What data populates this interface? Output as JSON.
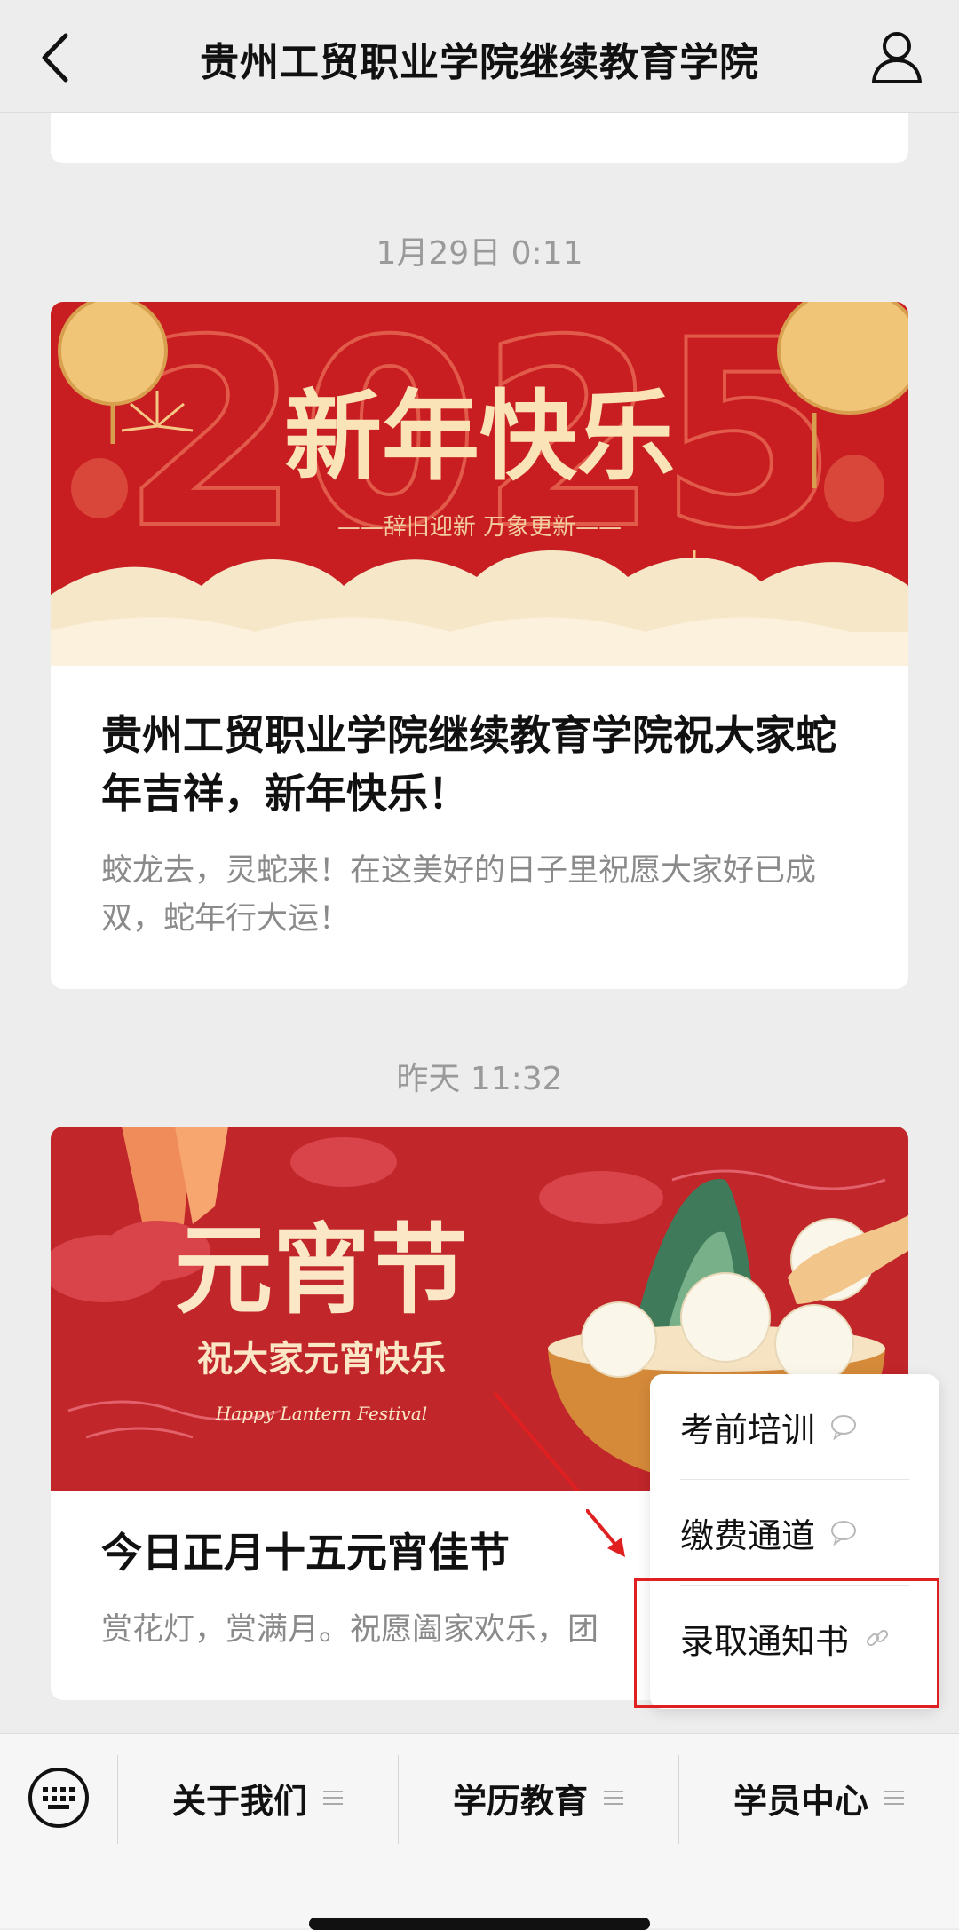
{
  "header": {
    "title": "贵州工贸职业学院继续教育学院"
  },
  "feed": [
    {
      "timestamp": "1月29日 0:11",
      "banner": {
        "main_text": "新年快乐",
        "sub_text": "——辞旧迎新  万象更新——",
        "year_text": "2025"
      },
      "headline": "贵州工贸职业学院继续教育学院祝大家蛇年吉祥，新年快乐！",
      "summary": "蛟龙去，灵蛇来！在这美好的日子里祝愿大家好已成双，蛇年行大运！"
    },
    {
      "timestamp": "昨天 11:32",
      "banner": {
        "main_text": "元宵节",
        "sub_text": "祝大家元宵快乐",
        "en_text": "Happy Lantern Festival"
      },
      "headline": "今日正月十五元宵佳节",
      "summary": "赏花灯，赏满月。祝愿阖家欢乐，团"
    }
  ],
  "popup_menu": {
    "items": [
      {
        "label": "考前培训",
        "icon": "chat-bubble-icon"
      },
      {
        "label": "缴费通道",
        "icon": "chat-bubble-icon"
      },
      {
        "label": "录取通知书",
        "icon": "link-icon"
      }
    ]
  },
  "bottom_menu": {
    "tabs": [
      {
        "label": "关于我们"
      },
      {
        "label": "学历教育"
      },
      {
        "label": "学员中心"
      }
    ]
  },
  "colors": {
    "banner_red": "#c81e22",
    "gold": "#f3d7a0",
    "annotation_red": "#e02020"
  }
}
